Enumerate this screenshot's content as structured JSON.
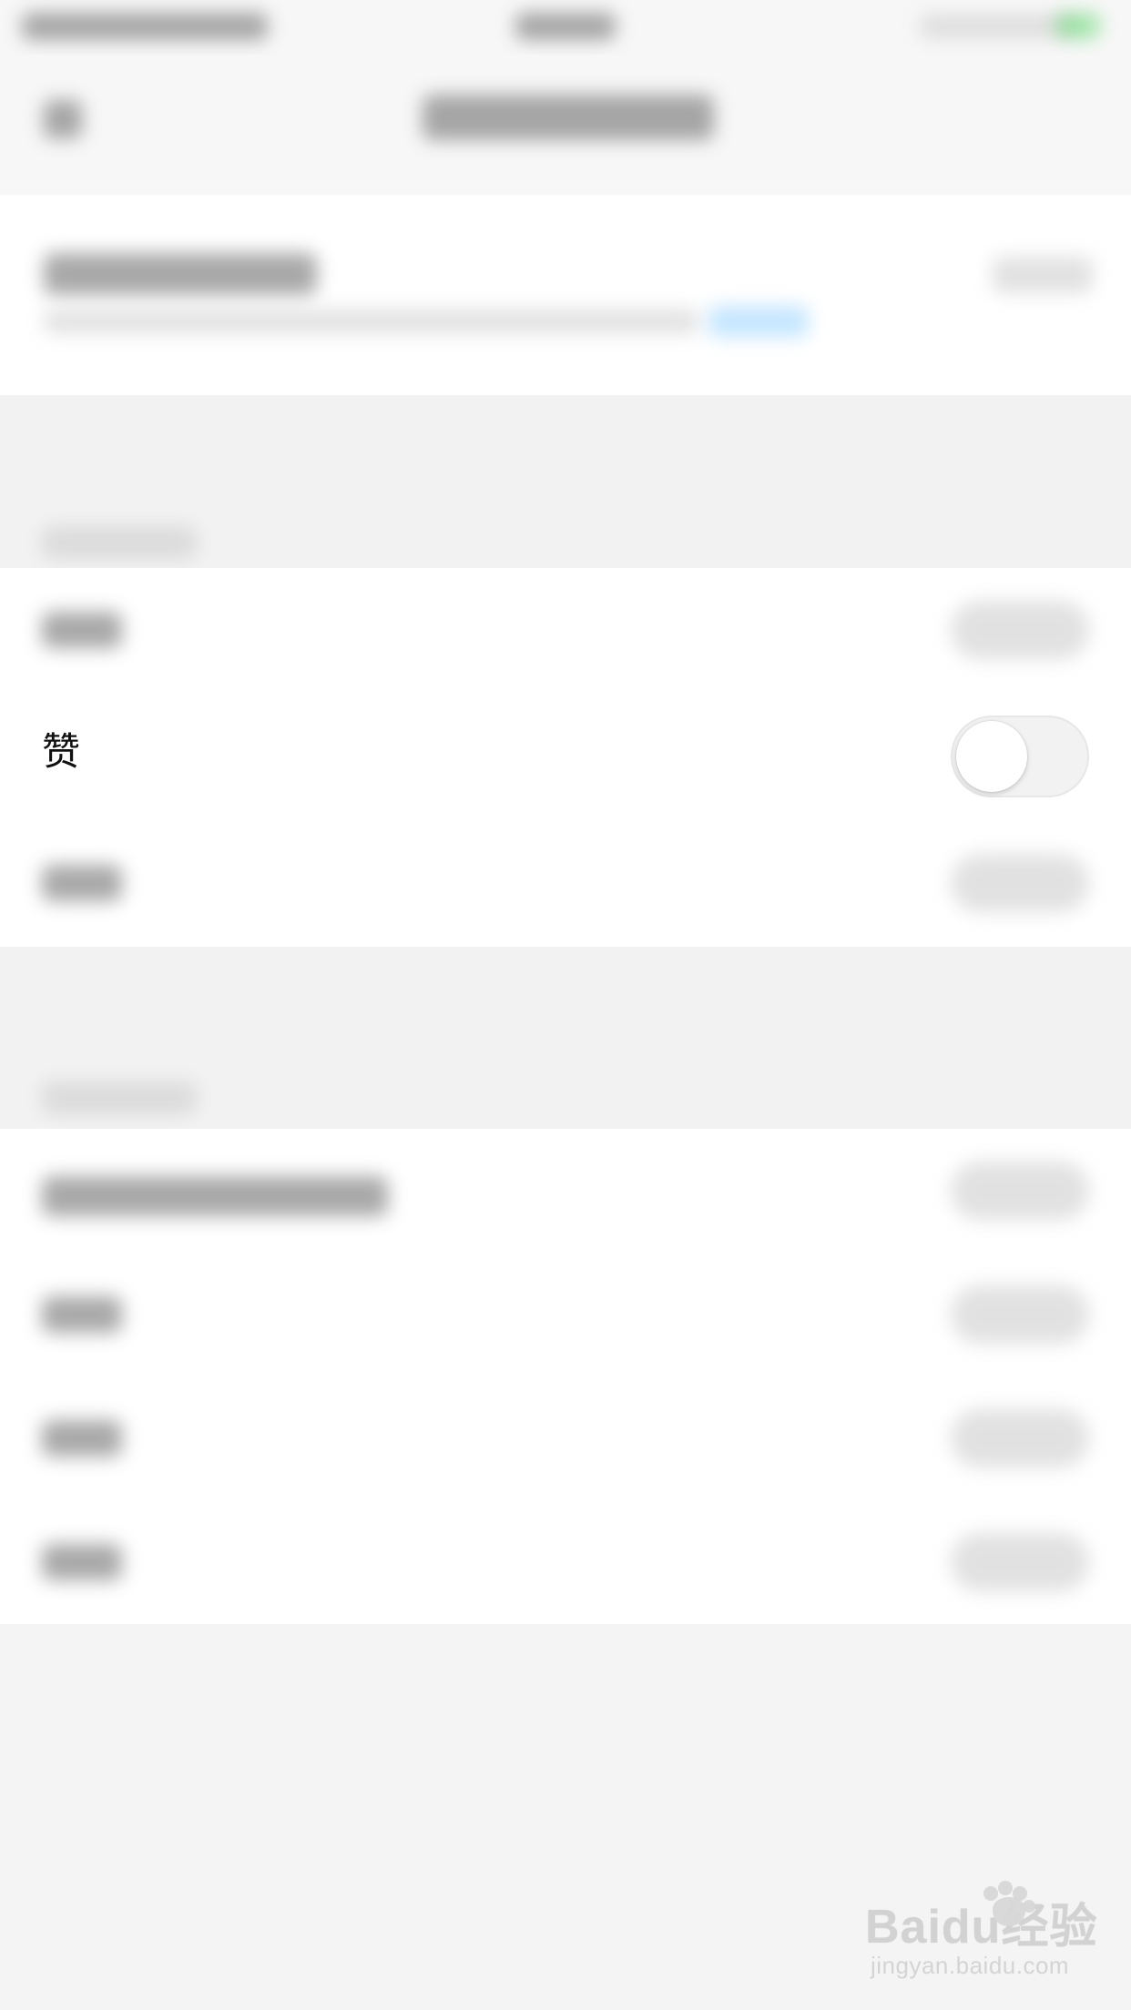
{
  "list": {
    "like_label": "赞"
  },
  "watermark": {
    "main_text": "Baidu经验",
    "sub_text": "jingyan.baidu.com"
  },
  "colors": {
    "background": "#f4f4f4",
    "row_background": "#ffffff",
    "separator": "#e6e6e6",
    "toggle_off_track": "#f2f2f2",
    "toggle_knob": "#ffffff"
  },
  "toggle": {
    "like_enabled": false
  },
  "icons": {
    "back": "chevron-left-icon",
    "toggle": "switch-icon",
    "brand": "baidu-paw-icon"
  }
}
